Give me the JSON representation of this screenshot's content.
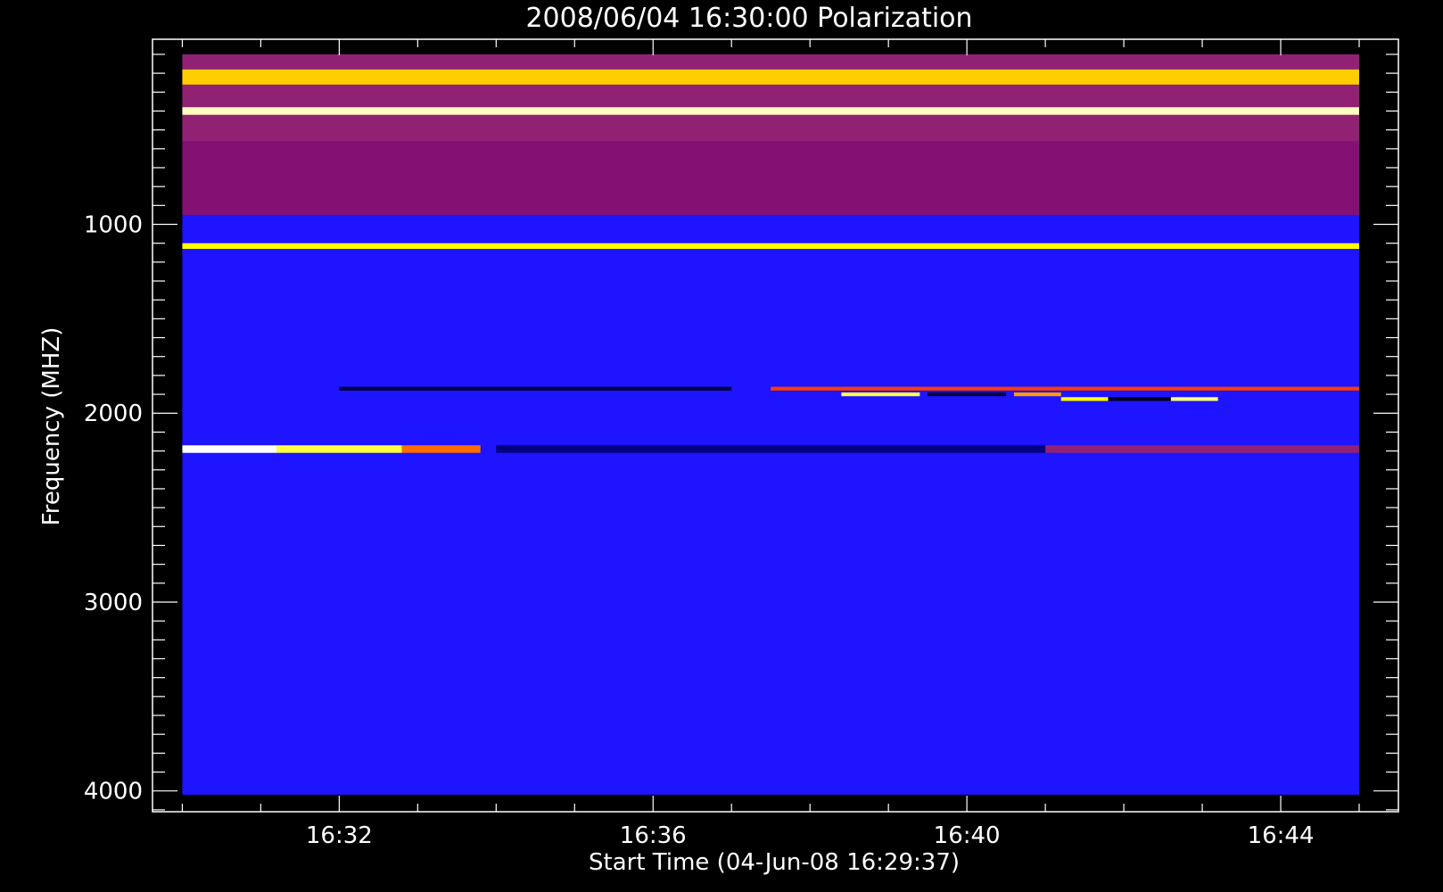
{
  "chart_data": {
    "type": "heatmap",
    "title": "2008/06/04 16:30:00 Polarization",
    "xlabel": "Start Time (04-Jun-08 16:29:37)",
    "ylabel": "Frequency (MHZ)",
    "x_tick_labels": [
      "16:32",
      "16:36",
      "16:40",
      "16:44"
    ],
    "x_tick_values_min": [
      2,
      6,
      10,
      14
    ],
    "x_minor_step_min": 1,
    "x_range_min": [
      -0.38,
      15.5
    ],
    "data_x_range_min": [
      0,
      15
    ],
    "y_tick_labels": [
      "1000",
      "2000",
      "3000",
      "4000"
    ],
    "y_tick_values": [
      1000,
      2000,
      3000,
      4000
    ],
    "y_minor_step": 100,
    "y_range": [
      20,
      4110
    ],
    "data_y_range": [
      100,
      4020
    ],
    "y_reversed": true,
    "colormap": [
      "#000000",
      "#0000ff",
      "#c80000",
      "#ff3c00",
      "#ffff00",
      "#ffffff"
    ],
    "background_color": "#1e14ff",
    "features": [
      {
        "f0": 100,
        "f1": 560,
        "t0": 0,
        "t1": 15,
        "level": 0.55
      },
      {
        "f0": 180,
        "f1": 260,
        "t0": 0,
        "t1": 15,
        "level": 0.75
      },
      {
        "f0": 380,
        "f1": 420,
        "t0": 0,
        "t1": 15,
        "level": 0.95
      },
      {
        "f0": 560,
        "f1": 950,
        "t0": 0,
        "t1": 15,
        "level": 0.45
      },
      {
        "f0": 1100,
        "f1": 1130,
        "t0": 0,
        "t1": 15,
        "level": 0.8
      },
      {
        "f0": 1860,
        "f1": 1880,
        "t0": 2,
        "t1": 7,
        "level": 0.05
      },
      {
        "f0": 1860,
        "f1": 1880,
        "t0": 7.5,
        "t1": 15,
        "level": 0.6
      },
      {
        "f0": 1890,
        "f1": 1910,
        "t0": 8.4,
        "t1": 9.4,
        "level": 0.85
      },
      {
        "f0": 1890,
        "f1": 1910,
        "t0": 9.5,
        "t1": 10.5,
        "level": 0.05
      },
      {
        "f0": 1890,
        "f1": 1910,
        "t0": 10.6,
        "t1": 11.2,
        "level": 0.7
      },
      {
        "f0": 1915,
        "f1": 1935,
        "t0": 11.2,
        "t1": 11.8,
        "level": 0.8
      },
      {
        "f0": 1915,
        "f1": 1935,
        "t0": 11.8,
        "t1": 12.6,
        "level": 0.02
      },
      {
        "f0": 1915,
        "f1": 1935,
        "t0": 12.6,
        "t1": 13.2,
        "level": 0.9
      },
      {
        "f0": 2170,
        "f1": 2210,
        "t0": 0,
        "t1": 1.2,
        "level": 1.0
      },
      {
        "f0": 2170,
        "f1": 2210,
        "t0": 1.2,
        "t1": 2.8,
        "level": 0.85
      },
      {
        "f0": 2170,
        "f1": 2210,
        "t0": 2.8,
        "t1": 3.8,
        "level": 0.65
      },
      {
        "f0": 2170,
        "f1": 2210,
        "t0": 4,
        "t1": 11,
        "level": 0.1
      },
      {
        "f0": 2170,
        "f1": 2210,
        "t0": 11,
        "t1": 15,
        "level": 0.55
      }
    ]
  }
}
